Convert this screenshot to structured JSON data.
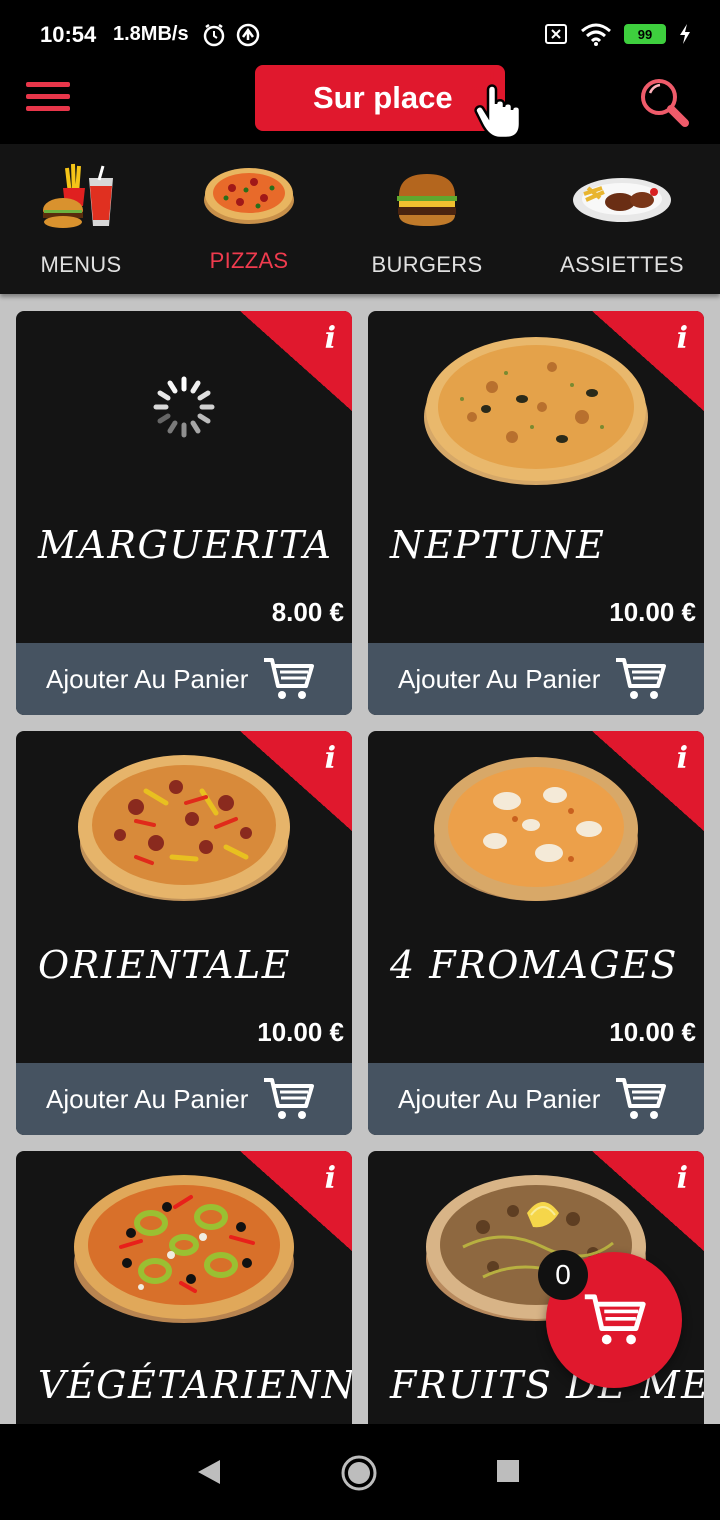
{
  "status_bar": {
    "time": "10:54",
    "speed": "1.8MB/s",
    "battery": "99"
  },
  "header": {
    "mode_button": "Sur place",
    "menu_icon": "hamburger-menu-icon",
    "search_icon": "search-icon",
    "accent_color": "#e0182d"
  },
  "categories": [
    {
      "label": "MENUS",
      "icon": "menu-combo-icon",
      "active": false
    },
    {
      "label": "PIZZAS",
      "icon": "pizza-icon",
      "active": true
    },
    {
      "label": "BURGERS",
      "icon": "burger-icon",
      "active": false
    },
    {
      "label": "ASSIETTES",
      "icon": "plate-icon",
      "active": false
    }
  ],
  "products": [
    {
      "name": "MARGUERITA",
      "price": "8.00 €",
      "add_label": "Ajouter Au Panier",
      "image": "loading-spinner"
    },
    {
      "name": "NEPTUNE",
      "price": "10.00 €",
      "add_label": "Ajouter Au Panier",
      "image": "pizza-neptune"
    },
    {
      "name": "ORIENTALE",
      "price": "10.00 €",
      "add_label": "Ajouter Au Panier",
      "image": "pizza-orientale"
    },
    {
      "name": "4 FROMAGES",
      "price": "10.00 €",
      "add_label": "Ajouter Au Panier",
      "image": "pizza-4-fromages"
    },
    {
      "name": "VÉGÉTARIENNE",
      "image": "pizza-vegetarienne"
    },
    {
      "name": "FRUITS DE MER",
      "image": "pizza-fruits-de-mer"
    }
  ],
  "info_icon": "i",
  "cart": {
    "count": "0",
    "icon": "cart-icon"
  }
}
